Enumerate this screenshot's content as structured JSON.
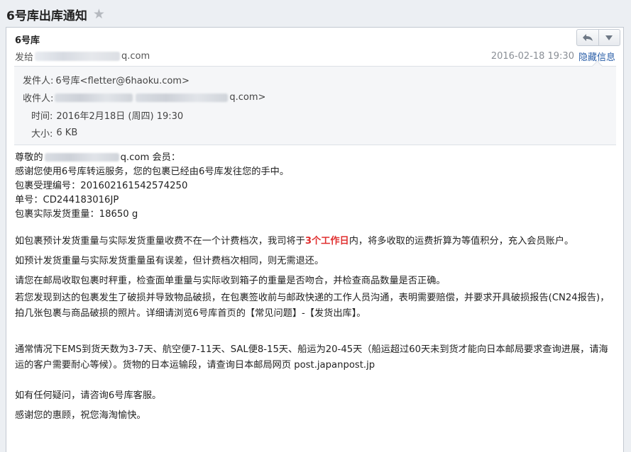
{
  "window": {
    "title": "6号库出库通知"
  },
  "message": {
    "sender_name": "6号库",
    "to_prefix": "发给",
    "to_suffix": "q.com",
    "date": "2016-02-18 19:30",
    "hide_info_label": "隐藏信息",
    "toolbar": {
      "reply_icon": "reply-arrow-icon",
      "more_icon": "dropdown-caret-icon"
    }
  },
  "details": {
    "from_label": "发件人:",
    "from_value": "6号库<fletter@6haoku.com>",
    "to_label": "收件人:",
    "to_tail": "q.com>",
    "time_label": "时间:",
    "time_value": "2016年2月18日 (周四) 19:30",
    "size_label": "大小:",
    "size_value": "6 KB"
  },
  "body": {
    "greeting_prefix": "尊敬的",
    "greeting_suffix": "q.com 会员：",
    "l1": "感谢您使用6号库转运服务，您的包裹已经由6号库发往您的手中。",
    "l2": "包裹受理编号：201602161542574250",
    "l3": "单号：CD244183016JP",
    "l4": "包裹实际发货重量：18650 g",
    "p1_a": "如包裹预计发货重量与实际发货重量收费不在一个计费档次，我司将于",
    "p1_red": "3个工作日",
    "p1_b": "内，将多收取的运费折算为等值积分，充入会员账户。",
    "p2": "如预计发货重量与实际发货重量虽有误差，但计费档次相同，则无需退还。",
    "p3": "请您在邮局收取包裹时秤重，检查面单重量与实际收到箱子的重量是否吻合，并检查商品数量是否正确。",
    "p4": "若您发现到达的包裹发生了破损并导致物品破损，在包裹签收前与邮政快递的工作人员沟通，表明需要赔偿，并要求开具破损报告(CN24报告)，拍几张包裹与商品破损的照片。详细请浏览6号库首页的【常见问题】-【发货出库】。",
    "p5": "通常情况下EMS到货天数为3-7天、航空便7-11天、SAL便8-15天、船运为20-45天（船运超过60天未到货才能向日本邮局要求查询进展，请海运的客户需要耐心等候）。货物的日本运输段，请查询日本邮局网页 post.japanpost.jp",
    "p6": "如有任何疑问，请咨询6号库客服。",
    "p7": "感谢您的惠顾，祝您海淘愉快。"
  }
}
